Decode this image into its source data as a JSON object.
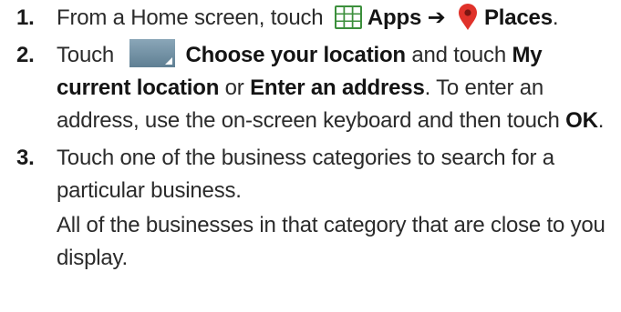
{
  "steps": [
    {
      "number": "1.",
      "parts": {
        "text_1": "From a Home screen, touch",
        "bold_1": "Apps",
        "arrow": "➔",
        "bold_2": "Places",
        "end": "."
      },
      "icons": [
        "apps-grid-icon",
        "places-pin-icon"
      ]
    },
    {
      "number": "2.",
      "parts": {
        "text_1": "Touch",
        "bold_1": "Choose your location",
        "text_2": " and touch ",
        "bold_2": "My current location",
        "text_3": " or ",
        "bold_3": "Enter an address",
        "text_4": ". To enter an address, use the on-screen keyboard and then touch ",
        "bold_4": "OK",
        "end": "."
      },
      "icons": [
        "choose-location-icon"
      ]
    },
    {
      "number": "3.",
      "parts": {
        "text_1": "Touch one of the business categories to search for a particular business."
      },
      "note": "All of the businesses in that category that are close to you display."
    }
  ],
  "colors": {
    "apps_icon": "#3c8f3c",
    "places_pin": "#e0322a",
    "location_icon": "#6f8fa3"
  }
}
